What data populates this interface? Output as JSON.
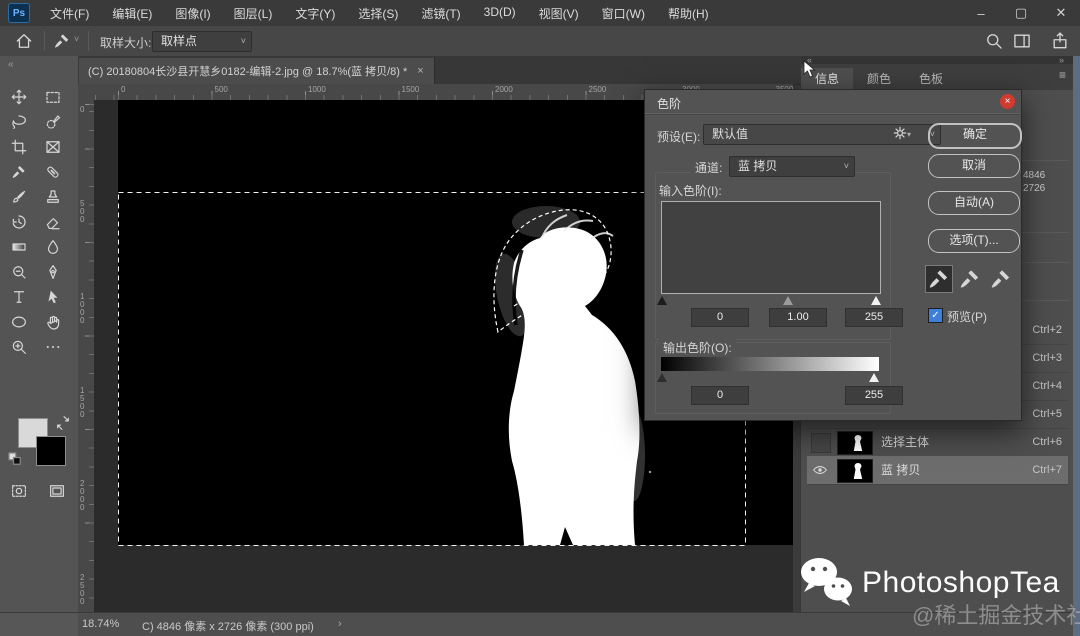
{
  "window": {
    "app_logo": "Ps",
    "controls": [
      {
        "name": "minimize",
        "glyph": "–"
      },
      {
        "name": "maximize",
        "glyph": "▢"
      },
      {
        "name": "close",
        "glyph": "✕"
      }
    ]
  },
  "menu_bar": {
    "items": [
      "文件(F)",
      "编辑(E)",
      "图像(I)",
      "图层(L)",
      "文字(Y)",
      "选择(S)",
      "滤镜(T)",
      "3D(D)",
      "视图(V)",
      "窗口(W)",
      "帮助(H)"
    ]
  },
  "options_bar": {
    "sample_size_label": "取样大小:",
    "sample_size_value": "取样点",
    "icons": [
      "home-icon",
      "eyedropper-tool-icon",
      "search-icon",
      "workspace-icon",
      "share-icon"
    ]
  },
  "document_tab": {
    "title": "(C) 20180804长沙县开慧乡0182-编辑-2.jpg @ 18.7%(蓝 拷贝/8) *",
    "close_glyph": "×"
  },
  "toolbar": {
    "collapse_glyph": "«",
    "tools": [
      {
        "name": "move",
        "icon": "move"
      },
      {
        "name": "marquee",
        "icon": "marquee"
      },
      {
        "name": "lasso",
        "icon": "lasso"
      },
      {
        "name": "quick-select",
        "icon": "quickselect"
      },
      {
        "name": "crop",
        "icon": "crop"
      },
      {
        "name": "frame",
        "icon": "frame"
      },
      {
        "name": "eyedropper",
        "icon": "dropper"
      },
      {
        "name": "healing-brush",
        "icon": "healing"
      },
      {
        "name": "brush",
        "icon": "brush"
      },
      {
        "name": "clone-stamp",
        "icon": "stamp"
      },
      {
        "name": "history-brush",
        "icon": "history"
      },
      {
        "name": "eraser",
        "icon": "eraser"
      },
      {
        "name": "gradient",
        "icon": "gradient"
      },
      {
        "name": "blur",
        "icon": "blur"
      },
      {
        "name": "dodge",
        "icon": "dodge"
      },
      {
        "name": "pen",
        "icon": "pen"
      },
      {
        "name": "type",
        "icon": "type"
      },
      {
        "name": "path-select",
        "icon": "pathsel"
      },
      {
        "name": "shape",
        "icon": "shape"
      },
      {
        "name": "hand",
        "icon": "hand"
      },
      {
        "name": "zoom",
        "icon": "zoomtool"
      },
      {
        "name": "more",
        "icon": "more"
      }
    ]
  },
  "rulers": {
    "horizontal_labels": [
      "0",
      "500",
      "1000",
      "1500",
      "2000",
      "2500",
      "3000",
      "3500"
    ],
    "vertical_labels": [
      "0",
      "500",
      "1000",
      "1500",
      "2000",
      "2500"
    ]
  },
  "canvas": {
    "background": "#000000",
    "figure_color": "#ffffff",
    "selection_color": "#ffffff"
  },
  "levels_dialog": {
    "title": "色阶",
    "preset_label": "预设(E):",
    "preset_value": "默认值",
    "channel_label": "通道:",
    "channel_value": "蓝 拷贝",
    "input_label": "输入色阶(I):",
    "input_black": "0",
    "input_gamma": "1.00",
    "input_white": "255",
    "output_label": "输出色阶(O):",
    "output_black": "0",
    "output_white": "255",
    "ok": "确定",
    "cancel": "取消",
    "auto": "自动(A)",
    "options": "选项(T)...",
    "preview_label": "预览(P)",
    "preview_checked": true,
    "close_glyph": "×",
    "eyedroppers": [
      "black-point-eyedropper",
      "gray-point-eyedropper",
      "white-point-eyedropper"
    ]
  },
  "right_panel": {
    "tabs": [
      {
        "label": "信息",
        "active": true
      },
      {
        "label": "颜色",
        "active": false
      },
      {
        "label": "色板",
        "active": false
      }
    ],
    "collapse_left": "«",
    "collapse_right": "»",
    "panel_menu_glyph": "≡",
    "info_values": [
      "4846",
      "2726"
    ],
    "channels": [
      {
        "name": "",
        "shortcut": "Ctrl+2",
        "eye": false,
        "thumb": false,
        "selected": false,
        "well": false
      },
      {
        "name": "",
        "shortcut": "Ctrl+3",
        "eye": false,
        "thumb": false,
        "selected": false,
        "well": false
      },
      {
        "name": "",
        "shortcut": "Ctrl+4",
        "eye": false,
        "thumb": false,
        "selected": false,
        "well": false
      },
      {
        "name": "",
        "shortcut": "Ctrl+5",
        "eye": false,
        "thumb": false,
        "selected": false,
        "well": false
      },
      {
        "name": "选择主体",
        "shortcut": "Ctrl+6",
        "eye": false,
        "thumb": true,
        "selected": false,
        "well": true
      },
      {
        "name": "蓝 拷贝",
        "shortcut": "Ctrl+7",
        "eye": true,
        "thumb": true,
        "selected": true,
        "well": false
      }
    ]
  },
  "status_bar": {
    "zoom": "18.74%",
    "doc_info": "C) 4846 像素 x 2726 像素 (300 ppi)",
    "chevron": "›"
  },
  "watermark": {
    "brand": "PhotoshopTea",
    "community": "@稀土掘金技术社区"
  },
  "colors": {
    "panel_bg": "#4e4e4e",
    "dialog_bg": "#535353",
    "canvas_black": "#000000",
    "selected_row": "#6d6d6d",
    "close_red": "#d33a2f",
    "checkbox_blue": "#3d7fd9",
    "edge_strip": "#5d6d7f"
  }
}
